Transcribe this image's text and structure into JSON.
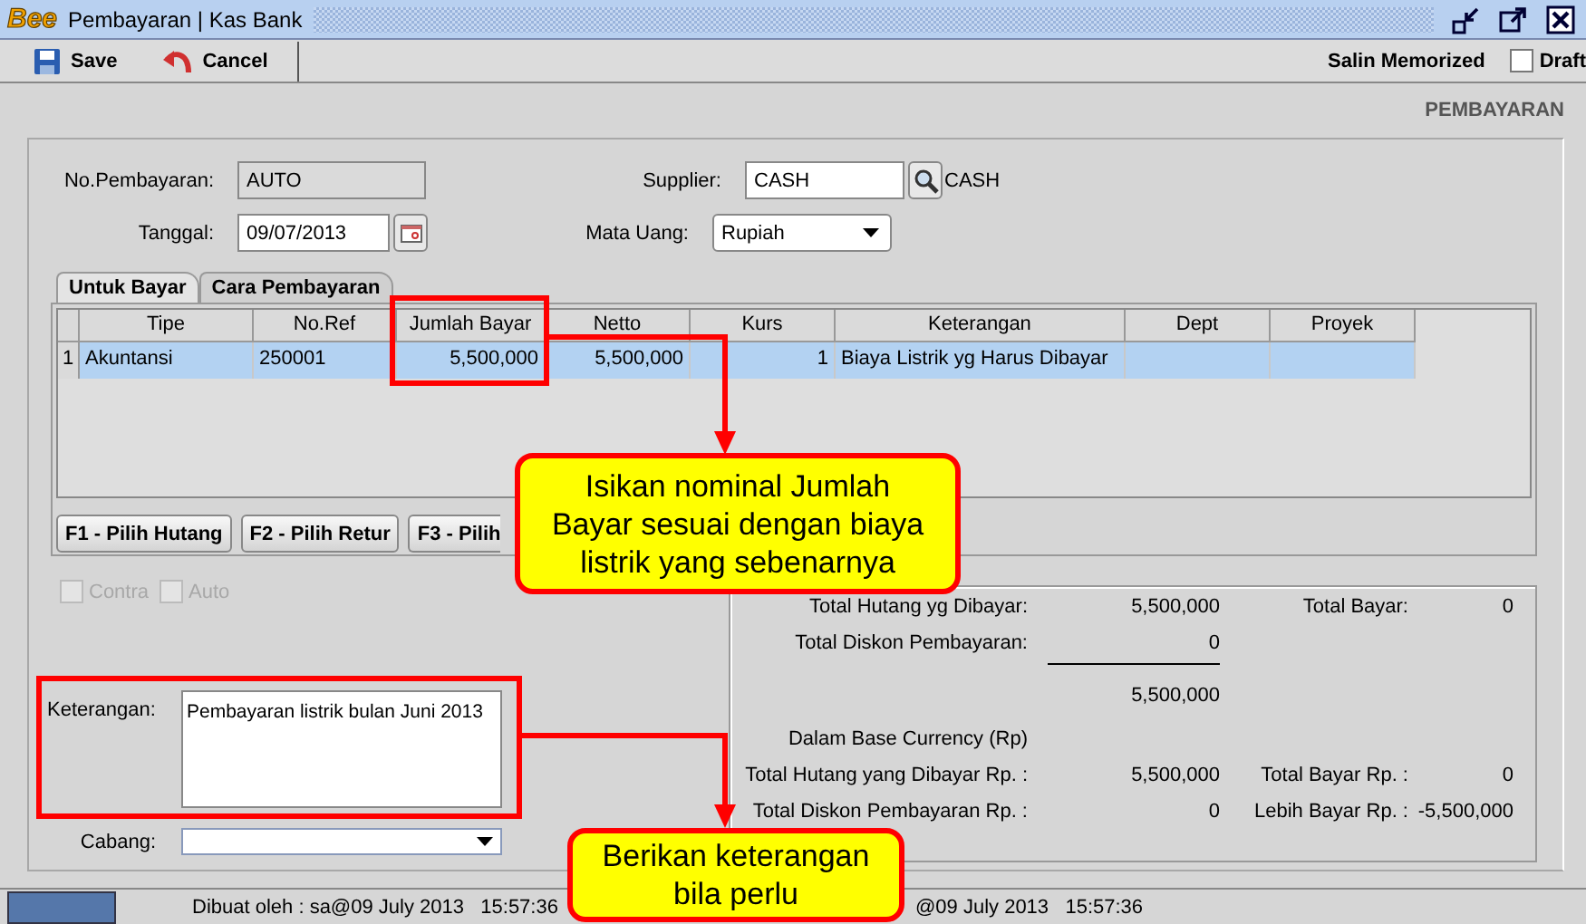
{
  "window": {
    "logo": "Bee",
    "title": "Pembayaran | Kas Bank"
  },
  "toolbar": {
    "buttons": [
      {
        "label": "Save",
        "kind": "save"
      },
      {
        "label": "Cancel",
        "kind": "cancel"
      }
    ],
    "memorized": "Salin Memorized",
    "draft": {
      "label": "Draft",
      "checked": false
    }
  },
  "form_title": "PEMBAYARAN",
  "fields": {
    "no_pembayaran": {
      "label": "No.Pembayaran:",
      "value": "AUTO",
      "disabled": true
    },
    "tanggal": {
      "label": "Tanggal:",
      "value": "09/07/2013"
    },
    "supplier": {
      "label": "Supplier:",
      "value": "CASH",
      "name": "CASH"
    },
    "mata_uang": {
      "label": "Mata Uang:",
      "value": "Rupiah"
    }
  },
  "tabs": [
    {
      "label": "Untuk Bayar",
      "selected": true
    },
    {
      "label": "Cara Pembayaran",
      "selected": false
    }
  ],
  "table": {
    "columns": [
      "Tipe",
      "No.Ref",
      "Jumlah Bayar",
      "Netto",
      "Kurs",
      "Keterangan",
      "Dept",
      "Proyek"
    ],
    "rows": [
      {
        "number": "1",
        "selected": true,
        "cells": [
          "Akuntansi",
          "250001",
          "5,500,000",
          "5,500,000",
          "1",
          "Biaya Listrik yg Harus Dibayar",
          "",
          ""
        ]
      }
    ]
  },
  "action_buttons": [
    "F1 - Pilih Hutang",
    "F2 - Pilih Retur",
    "F3 - Pilih"
  ],
  "options": [
    {
      "label": "Contra",
      "checked": false,
      "disabled": true
    },
    {
      "label": "Auto",
      "checked": false,
      "disabled": true
    }
  ],
  "keterangan": {
    "label": "Keterangan:",
    "value": "Pembayaran listrik bulan Juni 2013"
  },
  "cabang": {
    "label": "Cabang:"
  },
  "summary": [
    {
      "kind": "pair",
      "label": "Total Hutang yg Dibayar:",
      "value": "5,500,000",
      "label_2": "Total Bayar:",
      "value_2": "0"
    },
    {
      "kind": "pair",
      "label": "Total Diskon Pembayaran:",
      "value": "0"
    },
    {
      "kind": "rule"
    },
    {
      "kind": "pair",
      "value": "5,500,000"
    },
    {
      "kind": "heading",
      "label": "Dalam Base Currency (Rp)"
    },
    {
      "kind": "pair",
      "label": "Total Hutang yang Dibayar Rp. :",
      "value": "5,500,000",
      "label_2": "Total Bayar Rp. :",
      "value_2": "0"
    },
    {
      "kind": "pair",
      "label": "Total Diskon Pembayaran Rp. :",
      "value": "0",
      "label_2": "Lebih Bayar Rp. :",
      "value_2": "-5,500,000"
    }
  ],
  "status_bar": [
    "Dibuat oleh : sa@09 July 2013   15:57:36",
    "@09 July 2013   15:57:36"
  ],
  "annotations": [
    {
      "text": "Isikan nominal Jumlah Bayar sesuai dengan biaya listrik yang sebenarnya"
    },
    {
      "text": "Berikan keterangan bila perlu"
    }
  ]
}
